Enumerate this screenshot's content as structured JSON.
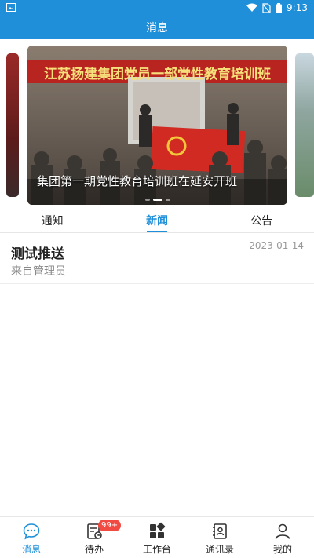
{
  "status_bar": {
    "time": "9:13"
  },
  "app_bar": {
    "title": "消息"
  },
  "carousel": {
    "banner_text": "江苏扬建集团党员一部党性教育培训班",
    "caption": "集团第一期党性教育培训班在延安开班"
  },
  "tabs": [
    {
      "label": "通知",
      "active": false
    },
    {
      "label": "新闻",
      "active": true
    },
    {
      "label": "公告",
      "active": false
    }
  ],
  "news": [
    {
      "title": "测试推送",
      "source": "来自管理员",
      "date": "2023-01-14"
    }
  ],
  "bottom_nav": [
    {
      "label": "消息",
      "icon": "chat-bubble-icon",
      "active": true
    },
    {
      "label": "待办",
      "icon": "task-list-icon",
      "badge": "99+"
    },
    {
      "label": "工作台",
      "icon": "workbench-grid-icon"
    },
    {
      "label": "通讯录",
      "icon": "contacts-icon"
    },
    {
      "label": "我的",
      "icon": "person-icon"
    }
  ],
  "colors": {
    "primary": "#1e8fd8",
    "badge": "#f04a43"
  }
}
